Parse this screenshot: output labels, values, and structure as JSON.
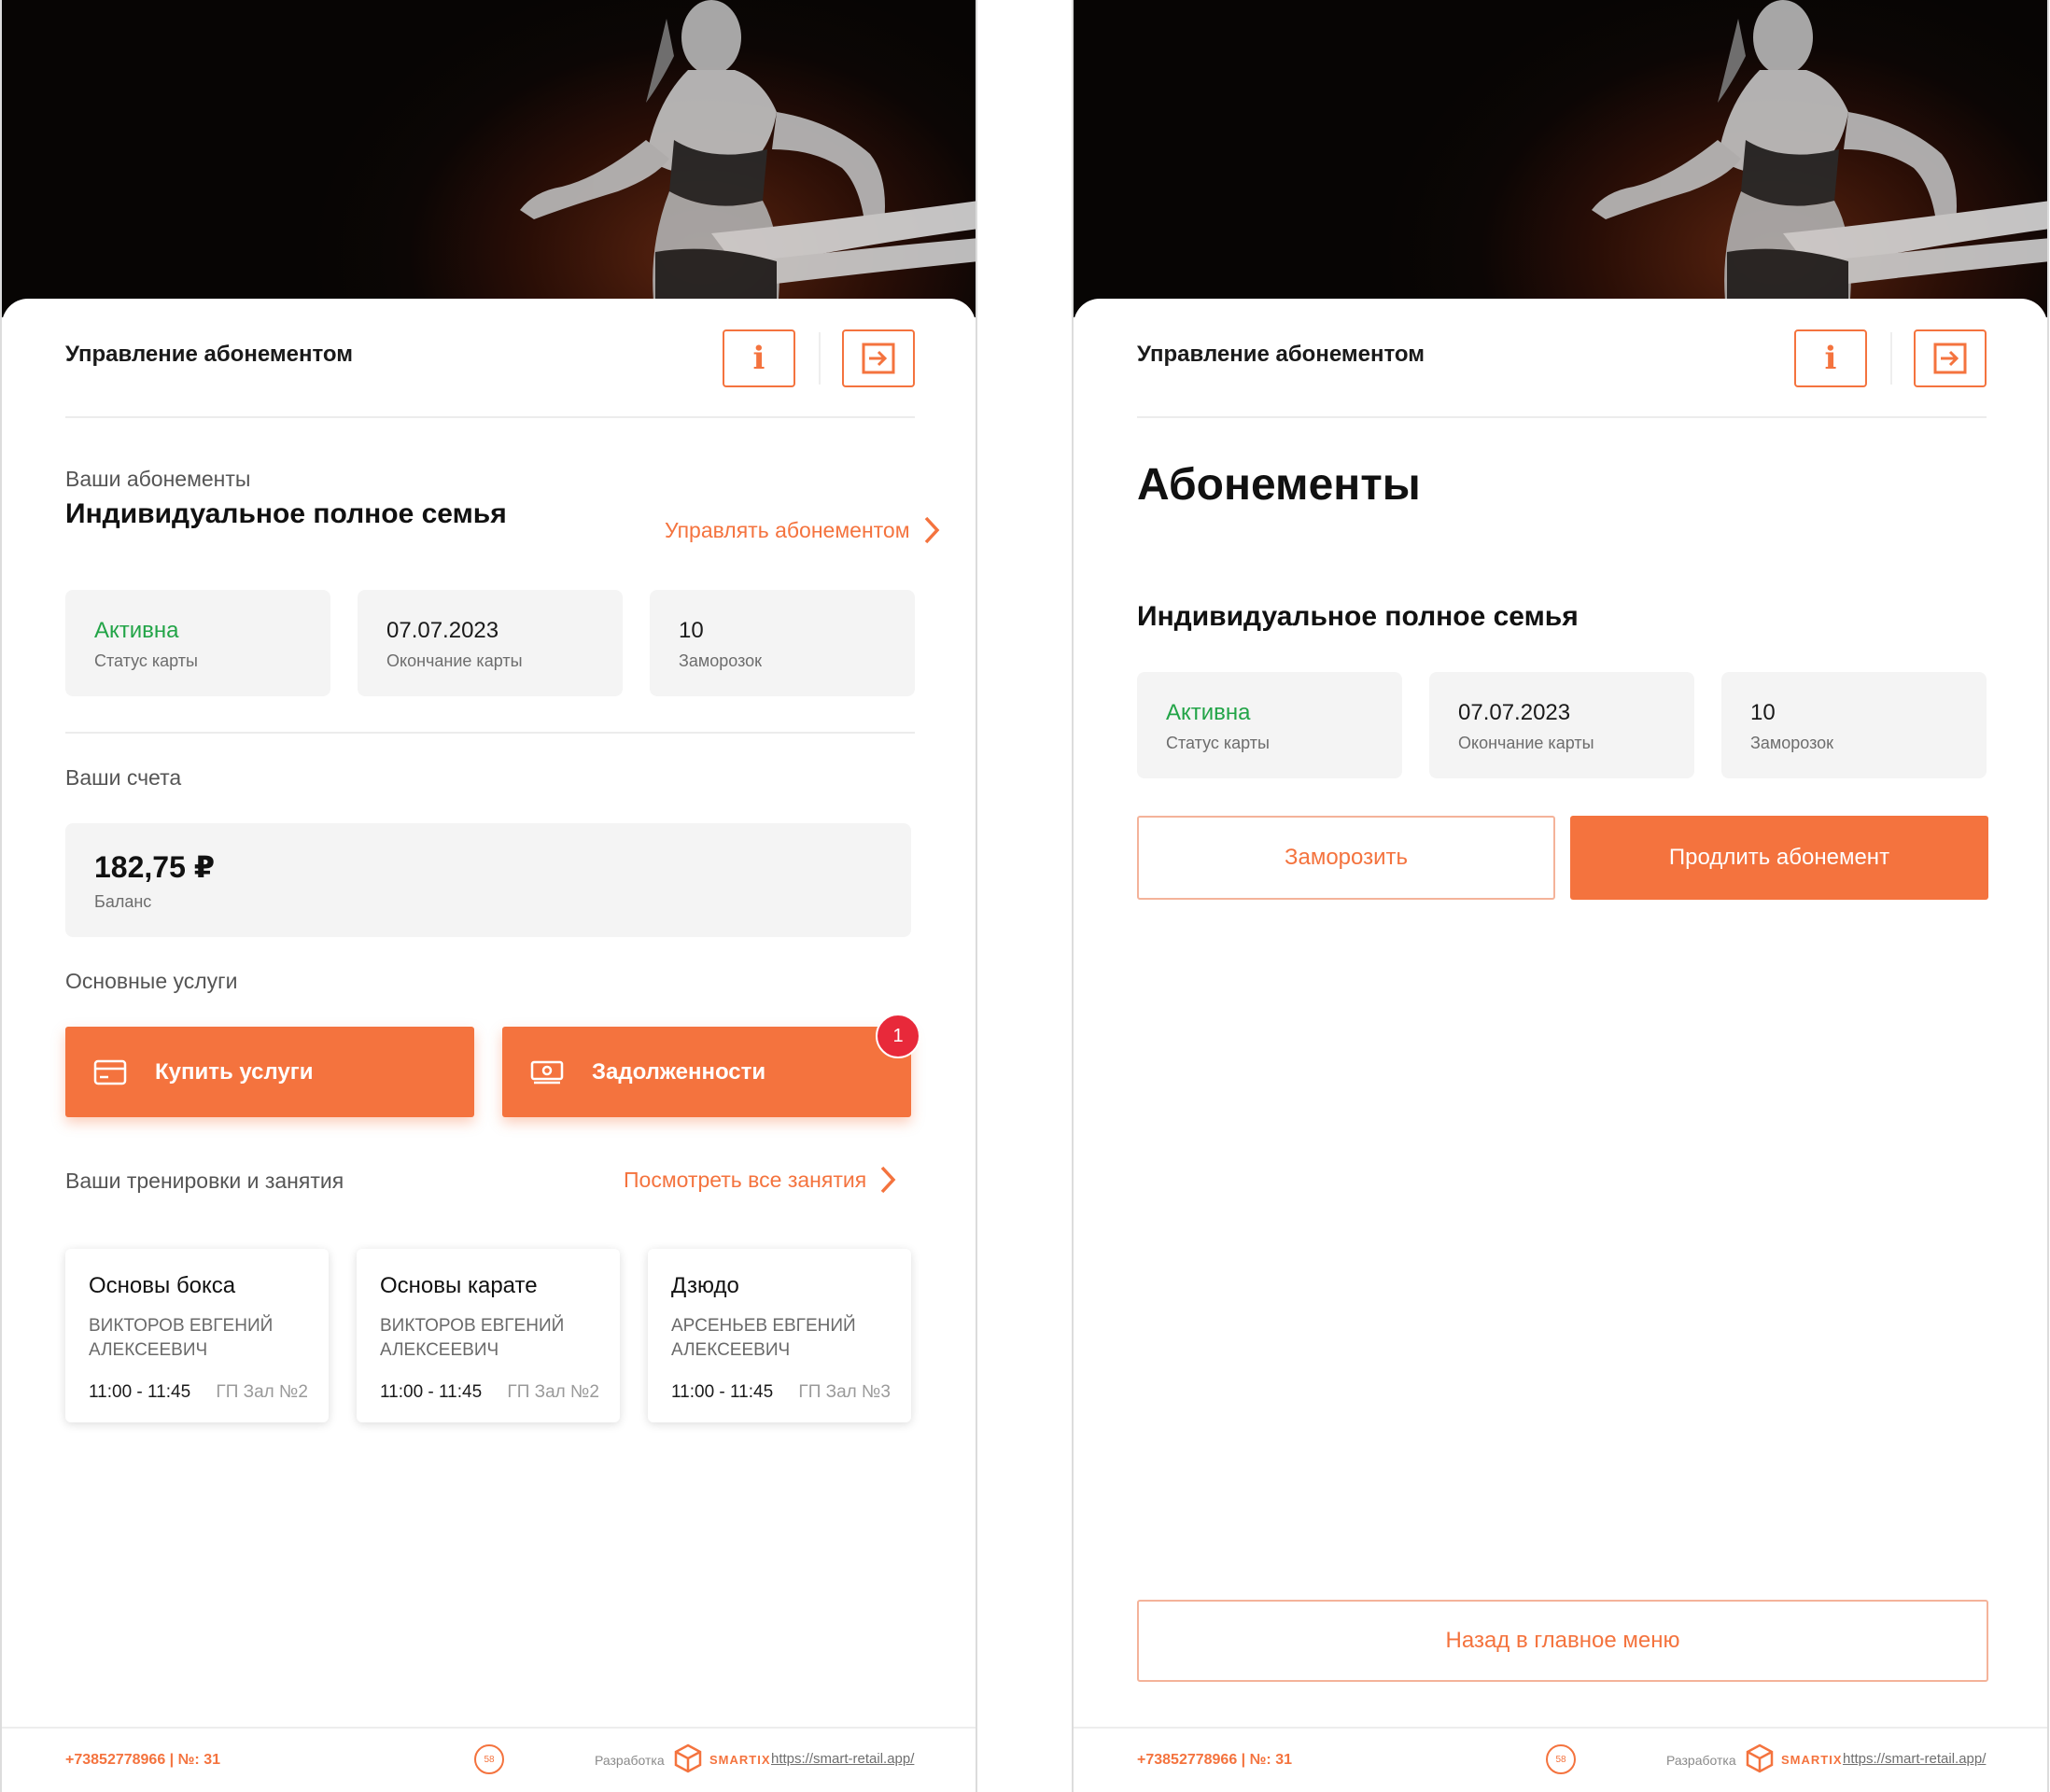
{
  "left_screen": {
    "header": {
      "title": "Управление абонементом",
      "info_icon": "info-icon",
      "exit_icon": "exit-icon"
    },
    "subscriptions": {
      "section_label": "Ваши абонементы",
      "plan_name": "Индивидуальное полное семья",
      "manage_link": "Управлять абонементом",
      "stats": [
        {
          "value": "Активна",
          "label": "Статус карты"
        },
        {
          "value": "07.07.2023",
          "label": "Окончание карты"
        },
        {
          "value": "10",
          "label": "Заморозок"
        }
      ]
    },
    "accounts": {
      "section_label": "Ваши счета",
      "balance": "182,75 ₽",
      "balance_label": "Баланс"
    },
    "services": {
      "section_label": "Основные услуги",
      "buy_label": "Купить услуги",
      "debts_label": "Задолженности",
      "debts_badge": "1"
    },
    "classes": {
      "section_label": "Ваши тренировки и занятия",
      "view_all_link": "Посмотреть все занятия",
      "items": [
        {
          "name": "Основы бокса",
          "coach": "ВИКТОРОВ ЕВГЕНИЙ АЛЕКСЕЕВИЧ",
          "time": "11:00 - 11:45",
          "room": "ГП Зал №2"
        },
        {
          "name": "Основы карате",
          "coach": "ВИКТОРОВ ЕВГЕНИЙ АЛЕКСЕЕВИЧ",
          "time": "11:00 - 11:45",
          "room": "ГП Зал №2"
        },
        {
          "name": "Дзюдо",
          "coach": "АРСЕНЬЕВ ЕВГЕНИЙ АЛЕКСЕЕВИЧ",
          "time": "11:00 - 11:45",
          "room": "ГП Зал №3"
        }
      ]
    }
  },
  "right_screen": {
    "header": {
      "title": "Управление абонементом",
      "info_icon": "info-icon",
      "exit_icon": "exit-icon"
    },
    "page_title": "Абонементы",
    "plan_name": "Индивидуальное полное семья",
    "stats": [
      {
        "value": "Активна",
        "label": "Статус карты"
      },
      {
        "value": "07.07.2023",
        "label": "Окончание карты"
      },
      {
        "value": "10",
        "label": "Заморозок"
      }
    ],
    "freeze_label": "Заморозить",
    "extend_label": "Продлить абонемент",
    "back_label": "Назад в главное меню"
  },
  "footer": {
    "phone": "+73852778966 | №: 31",
    "number_badge": "58",
    "dev_label": "Разработка",
    "brand": "SMARTIX",
    "url": "https://smart-retail.app/"
  },
  "colors": {
    "accent": "#f4733e",
    "active_status": "#22a447",
    "badge": "#e8293a",
    "card_bg": "#f4f4f4"
  }
}
